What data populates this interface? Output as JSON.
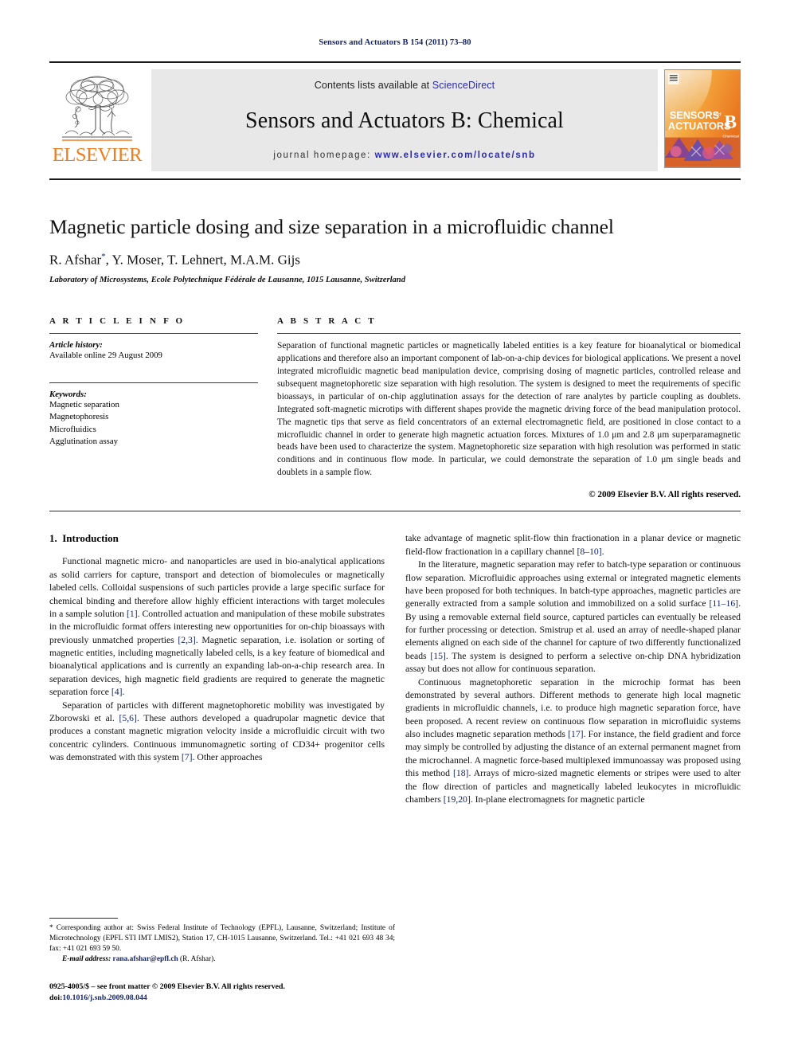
{
  "running_head": "Sensors and Actuators B 154 (2011) 73–80",
  "masthead": {
    "publisher_name": "ELSEVIER",
    "contents_prefix": "Contents lists available at ",
    "contents_link": "ScienceDirect",
    "journal_title": "Sensors and Actuators B: Chemical",
    "homepage_prefix": "journal homepage: ",
    "homepage_url": "www.elsevier.com/locate/snb",
    "cover_line1": "SENSORS",
    "cover_and": "and",
    "cover_line2": "ACTUATORS",
    "cover_series": "B",
    "cover_sub": "Chemical"
  },
  "article": {
    "title": "Magnetic particle dosing and size separation in a microfluidic channel",
    "authors": "R. Afshar",
    "corresponding_mark": "*",
    "authors_rest": ", Y. Moser, T. Lehnert, M.A.M. Gijs",
    "affiliation": "Laboratory of Microsystems, Ecole Polytechnique Fédérale de Lausanne, 1015 Lausanne, Switzerland"
  },
  "article_info": {
    "heading": "A R T I C L E    I N F O",
    "history_label": "Article history:",
    "history_value": "Available online 29 August 2009",
    "keywords_label": "Keywords:",
    "keywords": [
      "Magnetic separation",
      "Magnetophoresis",
      "Microfluidics",
      "Agglutination assay"
    ]
  },
  "abstract": {
    "heading": "A B S T R A C T",
    "text": "Separation of functional magnetic particles or magnetically labeled entities is a key feature for bioanalytical or biomedical applications and therefore also an important component of lab-on-a-chip devices for biological applications. We present a novel integrated microfluidic magnetic bead manipulation device, comprising dosing of magnetic particles, controlled release and subsequent magnetophoretic size separation with high resolution. The system is designed to meet the requirements of specific bioassays, in particular of on-chip agglutination assays for the detection of rare analytes by particle coupling as doublets. Integrated soft-magnetic microtips with different shapes provide the magnetic driving force of the bead manipulation protocol. The magnetic tips that serve as field concentrators of an external electromagnetic field, are positioned in close contact to a microfluidic channel in order to generate high magnetic actuation forces. Mixtures of 1.0 μm and 2.8 μm superparamagnetic beads have been used to characterize the system. Magnetophoretic size separation with high resolution was performed in static conditions and in continuous flow mode. In particular, we could demonstrate the separation of 1.0 μm single beads and doublets in a sample flow.",
    "copyright": "© 2009 Elsevier B.V. All rights reserved."
  },
  "introduction": {
    "section_number": "1.",
    "section_title": "Introduction",
    "left_paragraphs": [
      {
        "parts": [
          {
            "t": "Functional magnetic micro- and nanoparticles are used in bio-analytical applications as solid carriers for capture, transport and detection of biomolecules or magnetically labeled cells. Colloidal suspensions of such particles provide a large specific surface for chemical binding and therefore allow highly efficient interactions with target molecules in a sample solution "
          },
          {
            "t": "[1]",
            "ref": true
          },
          {
            "t": ". Controlled actuation and manipulation of these mobile substrates in the microfluidic format offers interesting new opportunities for on-chip bioassays with previously unmatched properties "
          },
          {
            "t": "[2,3]",
            "ref": true
          },
          {
            "t": ". Magnetic separation, i.e. isolation or sorting of magnetic entities, including magnetically labeled cells, is a key feature of biomedical and bioanalytical applications and is currently an expanding lab-on-a-chip research area. In separation devices, high magnetic field gradients are required to generate the magnetic separation force "
          },
          {
            "t": "[4]",
            "ref": true
          },
          {
            "t": "."
          }
        ]
      },
      {
        "parts": [
          {
            "t": "Separation of particles with different magnetophoretic mobility was investigated by Zborowski et al. "
          },
          {
            "t": "[5,6]",
            "ref": true
          },
          {
            "t": ". These authors developed a quadrupolar magnetic device that produces a constant magnetic migration velocity inside a microfluidic circuit with two concentric cylinders. Continuous immunomagnetic sorting of CD34+ progenitor cells was demonstrated with this system "
          },
          {
            "t": "[7]",
            "ref": true
          },
          {
            "t": ". Other approaches"
          }
        ]
      }
    ],
    "right_paragraphs": [
      {
        "parts": [
          {
            "t": "take advantage of magnetic split-flow thin fractionation in a planar device or magnetic field-flow fractionation in a capillary channel "
          },
          {
            "t": "[8–10]",
            "ref": true
          },
          {
            "t": "."
          }
        ],
        "noindent": true
      },
      {
        "parts": [
          {
            "t": "In the literature, magnetic separation may refer to batch-type separation or continuous flow separation. Microfluidic approaches using external or integrated magnetic elements have been proposed for both techniques. In batch-type approaches, magnetic particles are generally extracted from a sample solution and immobilized on a solid surface "
          },
          {
            "t": "[11–16]",
            "ref": true
          },
          {
            "t": ". By using a removable external field source, captured particles can eventually be released for further processing or detection. Smistrup et al. used an array of needle-shaped planar elements aligned on each side of the channel for capture of two differently functionalized beads "
          },
          {
            "t": "[15]",
            "ref": true
          },
          {
            "t": ". The system is designed to perform a selective on-chip DNA hybridization assay but does not allow for continuous separation."
          }
        ]
      },
      {
        "parts": [
          {
            "t": "Continuous magnetophoretic separation in the microchip format has been demonstrated by several authors. Different methods to generate high local magnetic gradients in microfluidic channels, i.e. to produce high magnetic separation force, have been proposed. A recent review on continuous flow separation in microfluidic systems also includes magnetic separation methods "
          },
          {
            "t": "[17]",
            "ref": true
          },
          {
            "t": ". For instance, the field gradient and force may simply be controlled by adjusting the distance of an external permanent magnet from the microchannel. A magnetic force-based multiplexed immunoassay was proposed using this method "
          },
          {
            "t": "[18]",
            "ref": true
          },
          {
            "t": ". Arrays of micro-sized magnetic elements or stripes were used to alter the flow direction of particles and magnetically labeled leukocytes in microfluidic chambers "
          },
          {
            "t": "[19,20]",
            "ref": true
          },
          {
            "t": ". In-plane electromagnets for magnetic particle"
          }
        ]
      }
    ]
  },
  "footnote": {
    "corresponding": "* Corresponding author at: Swiss Federal Institute of Technology (EPFL), Lausanne, Switzerland; Institute of Microtechnology (EPFL STI IMT LMIS2), Station 17, CH-1015 Lausanne, Switzerland. Tel.: +41 021 693 48 34; fax: +41 021 693 59 50.",
    "email_label": "E-mail address:",
    "email": "rana.afshar@epfl.ch",
    "email_owner": "(R. Afshar)."
  },
  "issn": {
    "line1": "0925-4005/$ – see front matter © 2009 Elsevier B.V. All rights reserved.",
    "doi_label": "doi:",
    "doi_value": "10.1016/j.snb.2009.08.044"
  },
  "colors": {
    "elsevier_orange": "#ef7d20",
    "link_blue": "#2b2ba8",
    "ref_blue": "#15256b",
    "band_grey": "#e8e8e8"
  }
}
